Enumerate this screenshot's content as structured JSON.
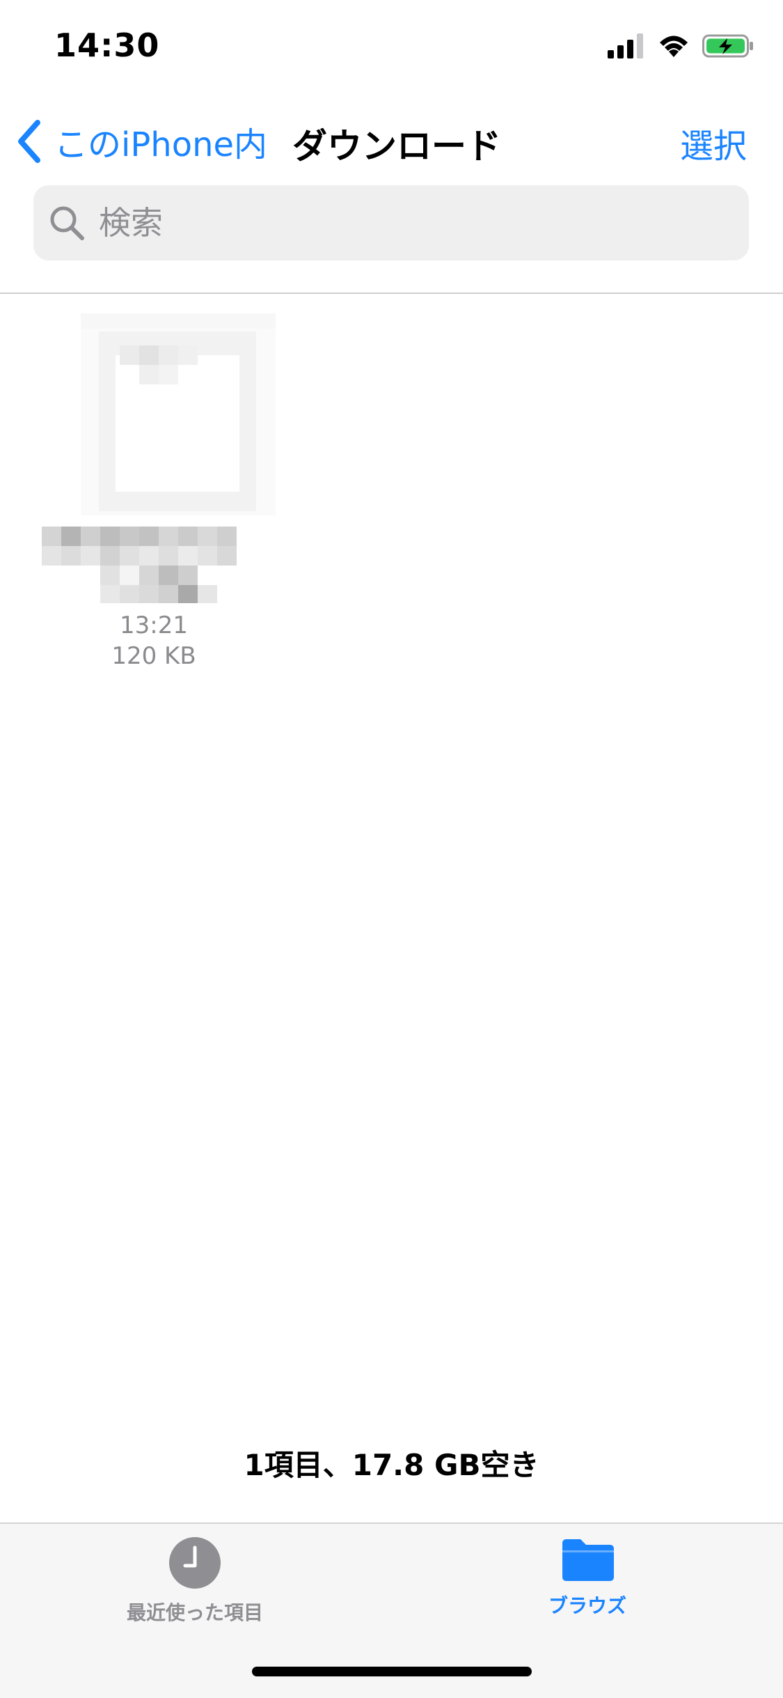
{
  "status_bar": {
    "time": "14:30"
  },
  "nav": {
    "back_label": "このiPhone内",
    "title": "ダウンロード",
    "select_label": "選択"
  },
  "search": {
    "placeholder": "検索"
  },
  "files": [
    {
      "time": "13:21",
      "size": "120 KB"
    }
  ],
  "storage_info": "1項目、17.8 GB空き",
  "tabs": {
    "recent_label": "最近使った項目",
    "browse_label": "ブラウズ"
  },
  "colors": {
    "accent": "#1a84ff",
    "inactive": "#8e8e93",
    "battery": "#34c759"
  }
}
